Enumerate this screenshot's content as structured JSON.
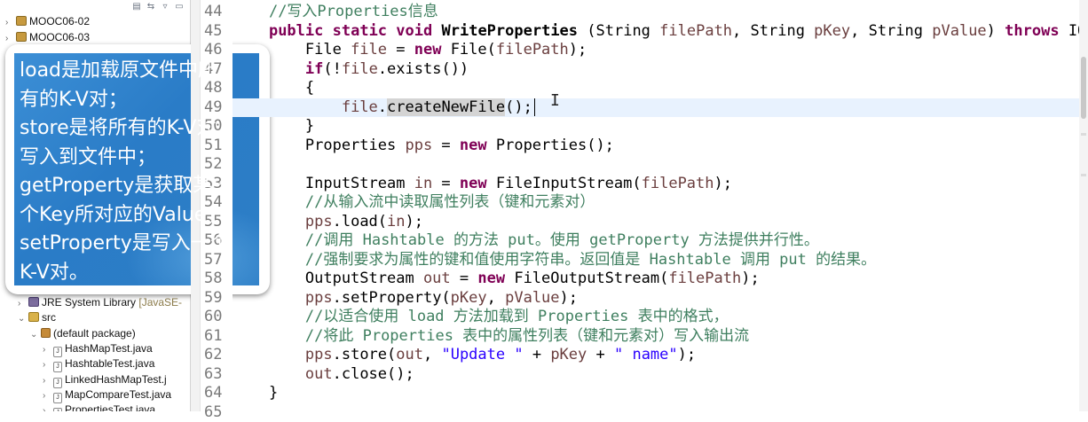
{
  "explorer": {
    "toolbar_icons": [
      "collapse-all-icon",
      "link-editor-icon",
      "view-menu-icon",
      "minimize-icon"
    ],
    "top_items": [
      {
        "label": "MOOC06-02",
        "type": "project"
      },
      {
        "label": "MOOC06-03",
        "type": "project"
      }
    ],
    "bottom_items": [
      {
        "label": "JRE System Library",
        "suffix": "[JavaSE-",
        "type": "library",
        "indent": 1
      },
      {
        "label": "src",
        "type": "src",
        "indent": 1,
        "expanded": true
      },
      {
        "label": "(default package)",
        "type": "package",
        "indent": 2,
        "expanded": true
      },
      {
        "label": "HashMapTest.java",
        "type": "java",
        "indent": 3
      },
      {
        "label": "HashtableTest.java",
        "type": "java",
        "indent": 3
      },
      {
        "label": "LinkedHashMapTest.j",
        "type": "java",
        "indent": 3
      },
      {
        "label": "MapCompareTest.java",
        "type": "java",
        "indent": 3
      },
      {
        "label": "PropertiesTest.java",
        "type": "java",
        "indent": 3
      }
    ]
  },
  "callout": {
    "lines": [
      "load是加载原文件中所",
      "有的K-V对；",
      "store是将所有的K-V对",
      "写入到文件中；",
      "getProperty是获取某一",
      "个Key所对应的Value；",
      "setProperty是写入一个",
      "K-V对。"
    ]
  },
  "editor": {
    "line_numbers": [
      "44",
      "45",
      "46",
      "47",
      "48",
      "49",
      "50",
      "51",
      "52",
      "53",
      "54",
      "55",
      "56",
      "57",
      "58",
      "59",
      "60",
      "61",
      "62",
      "63",
      "64",
      "65"
    ],
    "lines": [
      [
        {
          "t": "    "
        },
        {
          "t": "//写入Properties信息",
          "c": "cm"
        }
      ],
      [
        {
          "t": "    "
        },
        {
          "t": "public",
          "c": "kw"
        },
        {
          "t": " "
        },
        {
          "t": "static",
          "c": "kw"
        },
        {
          "t": " "
        },
        {
          "t": "void",
          "c": "kw"
        },
        {
          "t": " "
        },
        {
          "t": "WriteProperties",
          "c": "bo"
        },
        {
          "t": " (String "
        },
        {
          "t": "filePath",
          "c": "pr"
        },
        {
          "t": ", String "
        },
        {
          "t": "pKey",
          "c": "pr"
        },
        {
          "t": ", String "
        },
        {
          "t": "pValue",
          "c": "pr"
        },
        {
          "t": ") "
        },
        {
          "t": "throws",
          "c": "kw"
        },
        {
          "t": " IOExcep"
        }
      ],
      [
        {
          "t": "        File "
        },
        {
          "t": "file",
          "c": "pr"
        },
        {
          "t": " = "
        },
        {
          "t": "new",
          "c": "kw"
        },
        {
          "t": " File("
        },
        {
          "t": "filePath",
          "c": "pr"
        },
        {
          "t": ");"
        }
      ],
      [
        {
          "t": "        "
        },
        {
          "t": "if",
          "c": "kw"
        },
        {
          "t": "(!"
        },
        {
          "t": "file",
          "c": "pr"
        },
        {
          "t": ".exists())"
        }
      ],
      [
        {
          "t": "        {"
        }
      ],
      [
        {
          "t": "            "
        },
        {
          "t": "file",
          "c": "pr"
        },
        {
          "t": "."
        },
        {
          "t": "createNewFile",
          "c": "sel"
        },
        {
          "t": "();"
        },
        {
          "t": "",
          "c": "caret"
        }
      ],
      [
        {
          "t": "        }"
        }
      ],
      [
        {
          "t": "        Properties "
        },
        {
          "t": "pps",
          "c": "pr"
        },
        {
          "t": " = "
        },
        {
          "t": "new",
          "c": "kw"
        },
        {
          "t": " Properties();"
        }
      ],
      [
        {
          "t": ""
        }
      ],
      [
        {
          "t": "        InputStream "
        },
        {
          "t": "in",
          "c": "pr"
        },
        {
          "t": " = "
        },
        {
          "t": "new",
          "c": "kw"
        },
        {
          "t": " FileInputStream("
        },
        {
          "t": "filePath",
          "c": "pr"
        },
        {
          "t": ");"
        }
      ],
      [
        {
          "t": "        "
        },
        {
          "t": "//从输入流中读取属性列表（键和元素对）",
          "c": "cm"
        }
      ],
      [
        {
          "t": "        "
        },
        {
          "t": "pps",
          "c": "pr"
        },
        {
          "t": ".load("
        },
        {
          "t": "in",
          "c": "pr"
        },
        {
          "t": ");"
        }
      ],
      [
        {
          "t": "        "
        },
        {
          "t": "//调用 Hashtable 的方法 put。使用 getProperty 方法提供并行性。",
          "c": "cm"
        }
      ],
      [
        {
          "t": "        "
        },
        {
          "t": "//强制要求为属性的键和值使用字符串。返回值是 Hashtable 调用 put 的结果。",
          "c": "cm"
        }
      ],
      [
        {
          "t": "        OutputStream "
        },
        {
          "t": "out",
          "c": "pr"
        },
        {
          "t": " = "
        },
        {
          "t": "new",
          "c": "kw"
        },
        {
          "t": " FileOutputStream("
        },
        {
          "t": "filePath",
          "c": "pr"
        },
        {
          "t": ");"
        }
      ],
      [
        {
          "t": "        "
        },
        {
          "t": "pps",
          "c": "pr"
        },
        {
          "t": ".setProperty("
        },
        {
          "t": "pKey",
          "c": "pr"
        },
        {
          "t": ", "
        },
        {
          "t": "pValue",
          "c": "pr"
        },
        {
          "t": ");"
        }
      ],
      [
        {
          "t": "        "
        },
        {
          "t": "//以适合使用 load 方法加载到 Properties 表中的格式，",
          "c": "cm"
        }
      ],
      [
        {
          "t": "        "
        },
        {
          "t": "//将此 Properties 表中的属性列表（键和元素对）写入输出流",
          "c": "cm"
        }
      ],
      [
        {
          "t": "        "
        },
        {
          "t": "pps",
          "c": "pr"
        },
        {
          "t": ".store("
        },
        {
          "t": "out",
          "c": "pr"
        },
        {
          "t": ", "
        },
        {
          "t": "\"Update \"",
          "c": "st"
        },
        {
          "t": " + "
        },
        {
          "t": "pKey",
          "c": "pr"
        },
        {
          "t": " + "
        },
        {
          "t": "\" name\"",
          "c": "st"
        },
        {
          "t": ");"
        }
      ],
      [
        {
          "t": "        "
        },
        {
          "t": "out",
          "c": "pr"
        },
        {
          "t": ".close();"
        }
      ],
      [
        {
          "t": "    }"
        }
      ],
      [
        {
          "t": ""
        }
      ]
    ],
    "highlighted_line": 5,
    "colors": {
      "keyword": "#7f0055",
      "comment": "#3f7f5f",
      "string": "#2a00ff",
      "variable": "#6a3e3e",
      "callout_bg": "#2d7ec6"
    }
  }
}
